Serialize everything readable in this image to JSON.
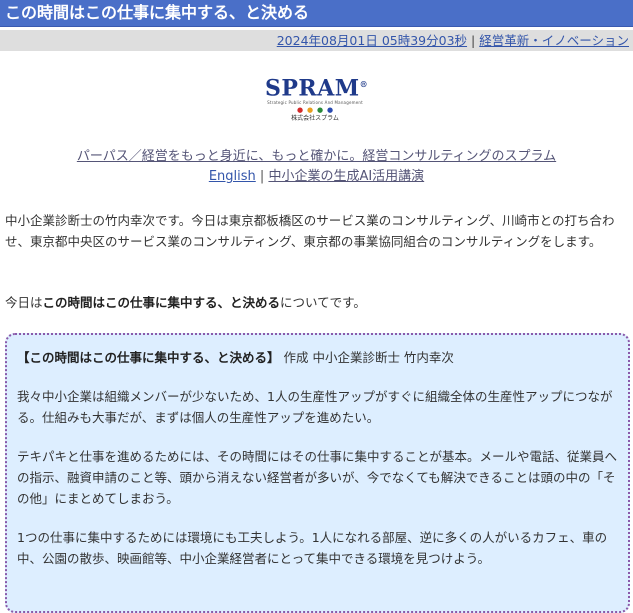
{
  "header": {
    "title": "この時間はこの仕事に集中する、と決める"
  },
  "meta": {
    "datetime": "2024年08月01日 05時39分03秒",
    "separator": "|",
    "category": "経営革新・イノベーション"
  },
  "logo": {
    "wordmark": "SPRAM",
    "reg_mark": "®",
    "subtitle": "Strategic Public Relations And Management",
    "dot_colors": [
      "#d42a2a",
      "#e8a020",
      "#2a8a3a",
      "#2a4ab0"
    ],
    "company": "株式会社スプラム"
  },
  "tagline": {
    "text": "パーパス／経営をもっと身近に、もっと確かに。経営コンサルティングのスプラム"
  },
  "links": {
    "english": "English",
    "separator": "|",
    "ai_course": "中小企業の生成AI活用講演"
  },
  "intro": {
    "text": "中小企業診断士の竹内幸次です。今日は東京都板橋区のサービス業のコンサルティング、川崎市との打ち合わせ、東京都中央区のサービス業のコンサルティング、東京都の事業協同組合のコンサルティングをします。"
  },
  "today": {
    "prefix": "今日は",
    "topic": "この時間はこの仕事に集中する、と決める",
    "suffix": "についてです。"
  },
  "article": {
    "heading_bold": "【この時間はこの仕事に集中する、と決める】",
    "heading_author": " 作成 中小企業診断士 竹内幸次",
    "paragraphs": [
      "我々中小企業は組織メンバーが少ないため、1人の生産性アップがすぐに組織全体の生産性アップにつながる。仕組みも大事だが、まずは個人の生産性アップを進めたい。",
      "テキパキと仕事を進めるためには、その時間にはその仕事に集中することが基本。メールや電話、従業員への指示、融資申請のこと等、頭から消えない経営者が多いが、今でなくても解決できることは頭の中の「その他」にまとめてしまおう。",
      "1つの仕事に集中するためには環境にも工夫しよう。1人になれる部屋、逆に多くの人がいるカフェ、車の中、公園の散歩、映画館等、中小企業経営者にとって集中できる環境を見つけよう。"
    ]
  }
}
